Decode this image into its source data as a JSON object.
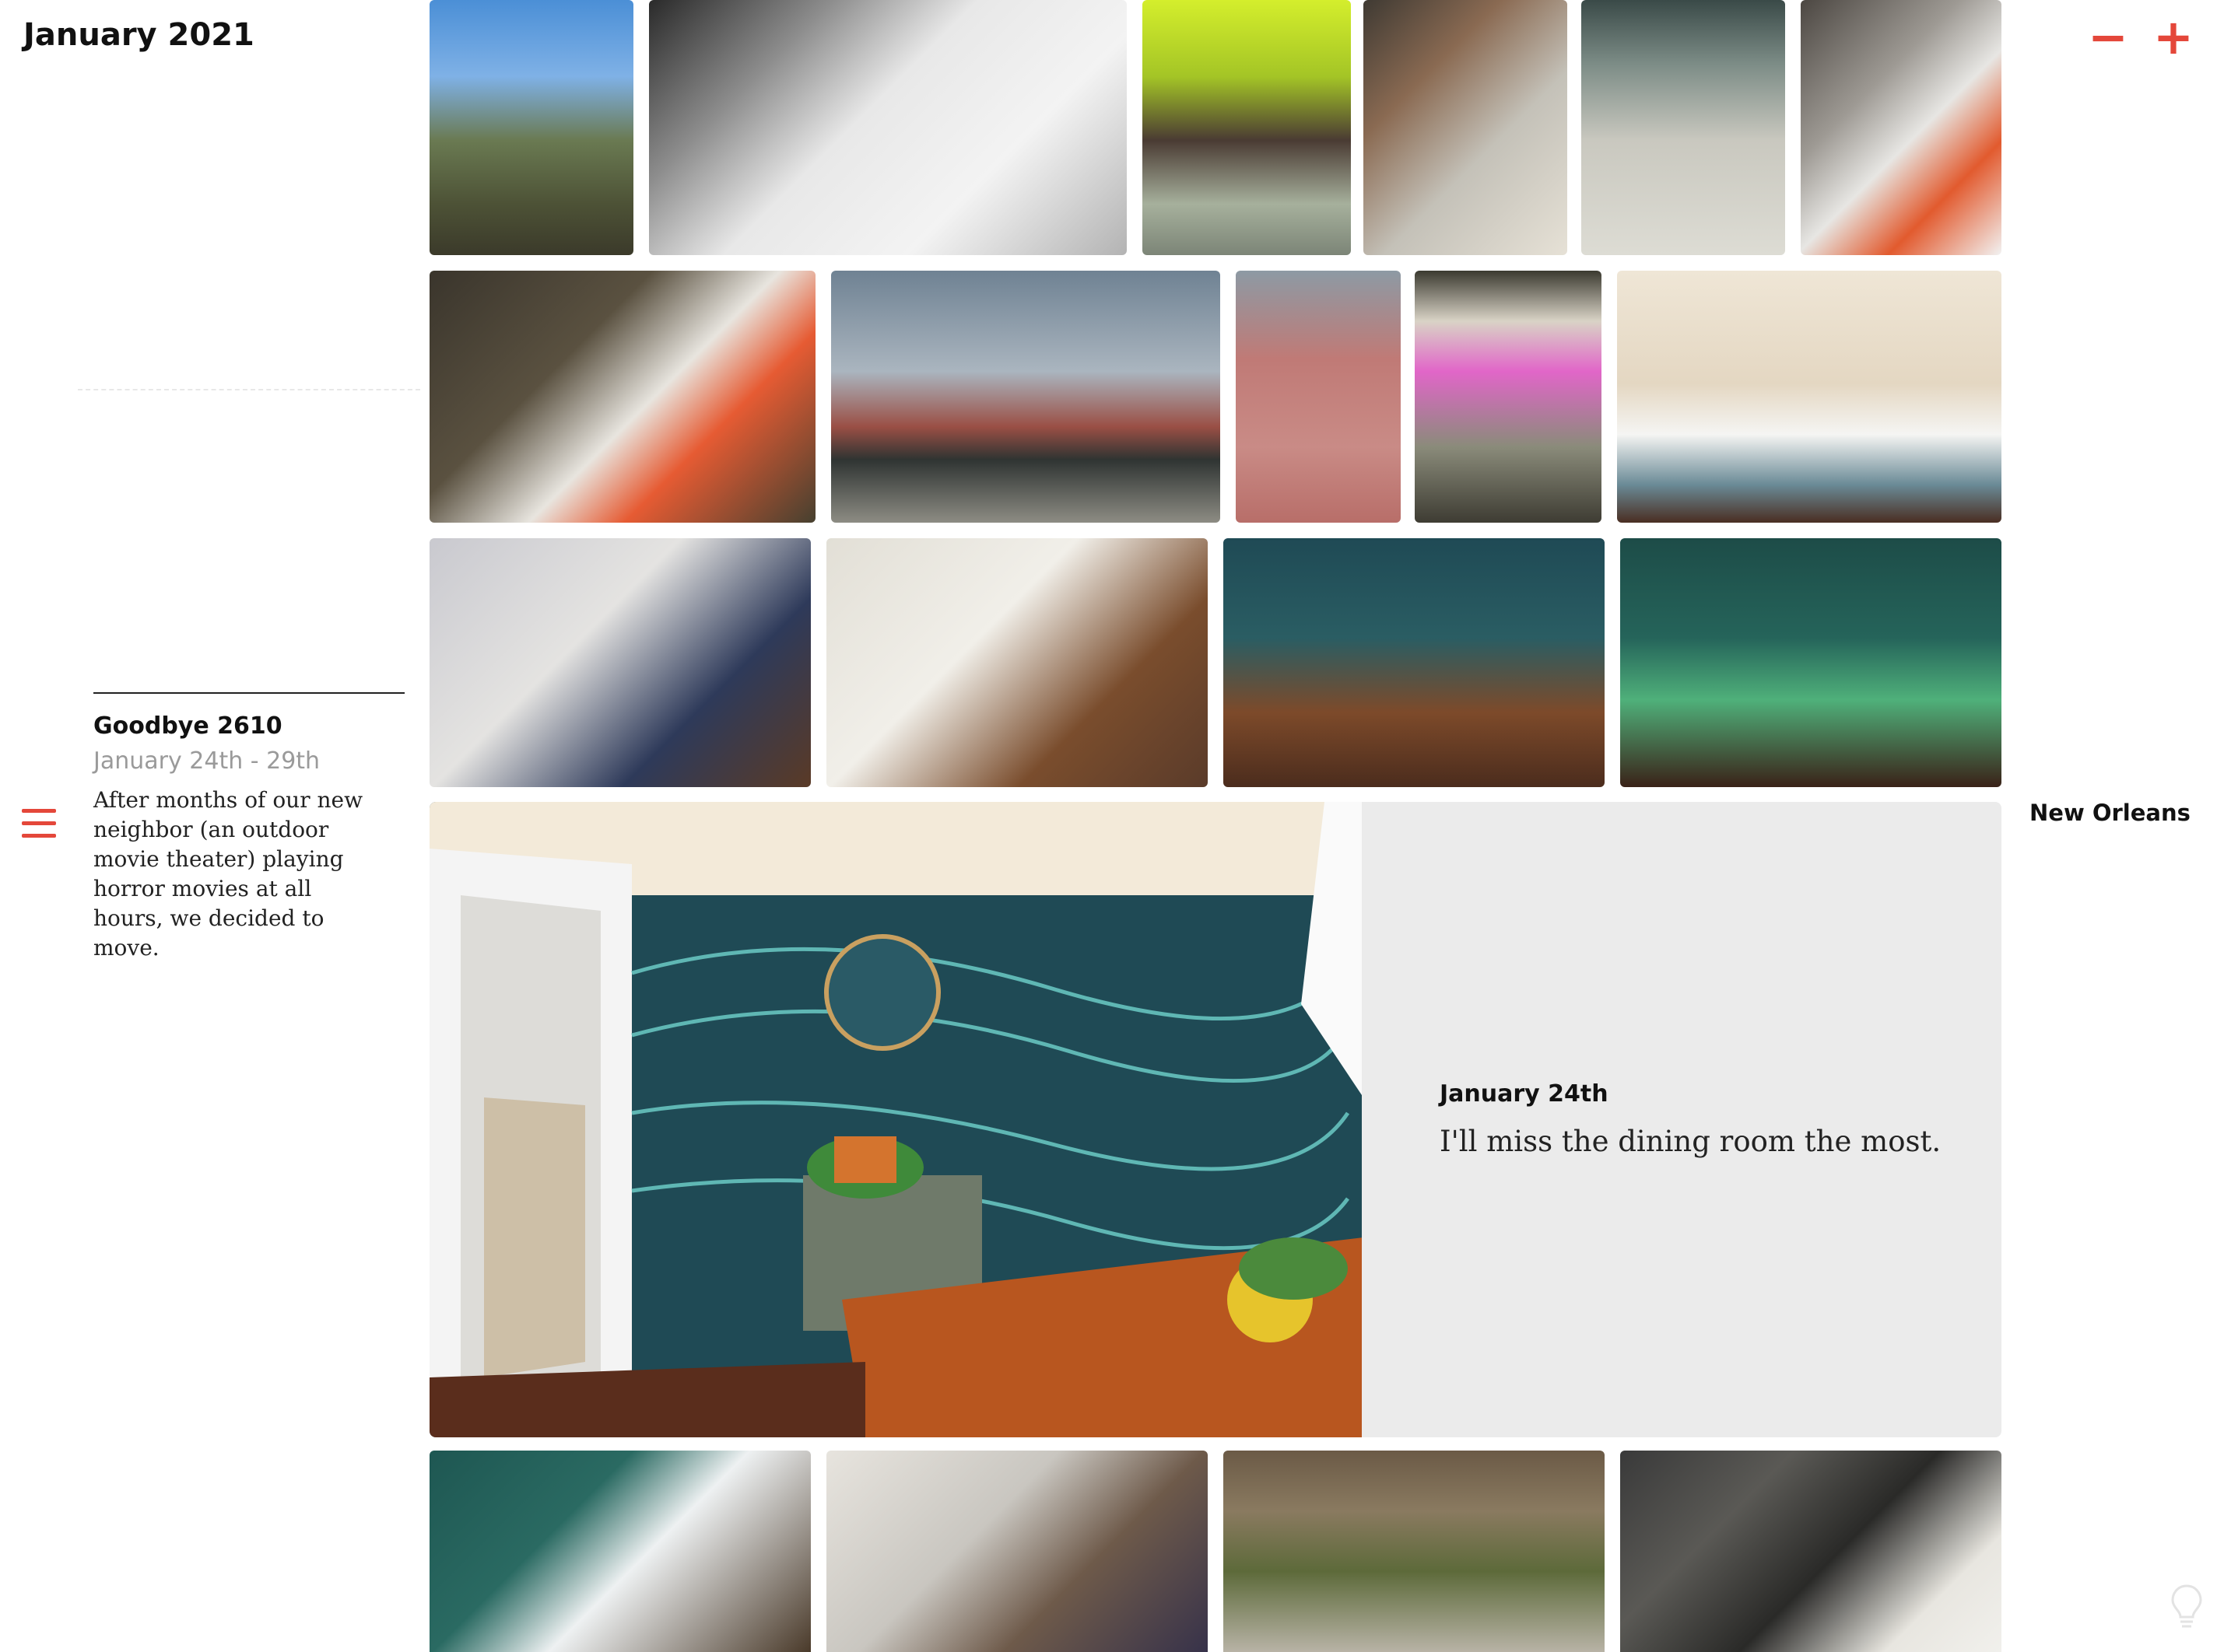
{
  "header": {
    "month_title": "January 2021"
  },
  "zoom": {
    "zoom_out_label": "−",
    "zoom_in_label": "+"
  },
  "event": {
    "title": "Goodbye 2610",
    "dates": "January 24th - 29th",
    "description": "After months of our new neighbor (an outdoor movie theater) playing horror movies at all hours, we decided to move."
  },
  "location": {
    "label": "New Orleans"
  },
  "featured_caption": {
    "date": "January 24th",
    "text": "I'll miss the dining room the most."
  },
  "colors": {
    "accent": "#e4473a",
    "caption_bg": "#ebebeb",
    "dark_teal_wall": "#1f4a55"
  },
  "icons": [
    "zoom-out-icon",
    "zoom-in-icon",
    "hamburger-menu-icon",
    "lightbulb-icon"
  ]
}
